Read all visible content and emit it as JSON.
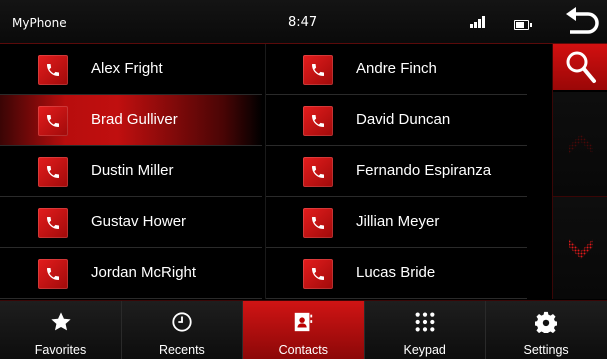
{
  "status": {
    "device_name": "MyPhone",
    "time": "8:47"
  },
  "contacts": [
    {
      "name": "Alex Fright",
      "selected": false
    },
    {
      "name": "Andre Finch",
      "selected": false
    },
    {
      "name": "Brad Gulliver",
      "selected": true
    },
    {
      "name": "David Duncan",
      "selected": false
    },
    {
      "name": "Dustin Miller",
      "selected": false
    },
    {
      "name": "Fernando Espiranza",
      "selected": false
    },
    {
      "name": "Gustav Hower",
      "selected": false
    },
    {
      "name": "Jillian Meyer",
      "selected": false
    },
    {
      "name": "Jordan McRight",
      "selected": false
    },
    {
      "name": "Lucas Bride",
      "selected": false
    }
  ],
  "tabs": [
    {
      "label": "Favorites",
      "icon": "star-icon",
      "active": false
    },
    {
      "label": "Recents",
      "icon": "clock-icon",
      "active": false
    },
    {
      "label": "Contacts",
      "icon": "contact-book-icon",
      "active": true
    },
    {
      "label": "Keypad",
      "icon": "keypad-icon",
      "active": false
    },
    {
      "label": "Settings",
      "icon": "gear-icon",
      "active": false
    }
  ],
  "colors": {
    "accent": "#c00f0f",
    "background": "#000000",
    "text": "#ffffff"
  }
}
